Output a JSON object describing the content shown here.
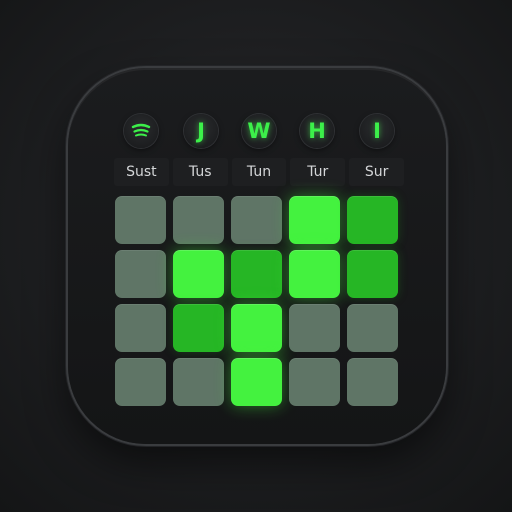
{
  "header": {
    "badges": [
      {
        "icon": "spotify-icon",
        "label": ""
      },
      {
        "label": "J"
      },
      {
        "label": "W"
      },
      {
        "label": "H"
      },
      {
        "label": "I"
      }
    ]
  },
  "days": [
    "Sust",
    "Tus",
    "Tun",
    "Tur",
    "Sur"
  ],
  "grid": {
    "rows": [
      [
        0,
        0,
        0,
        3,
        1
      ],
      [
        0,
        3,
        1,
        3,
        1
      ],
      [
        0,
        1,
        3,
        0,
        0
      ],
      [
        0,
        0,
        3,
        0,
        0
      ]
    ],
    "legend_levels": {
      "0": "#5f7566",
      "1": "#26b625",
      "2": "#37d834",
      "3": "#44f23f"
    }
  },
  "colors": {
    "accent": "#3cf04a",
    "background": "#1d1e20",
    "icon_body": "#141516"
  }
}
